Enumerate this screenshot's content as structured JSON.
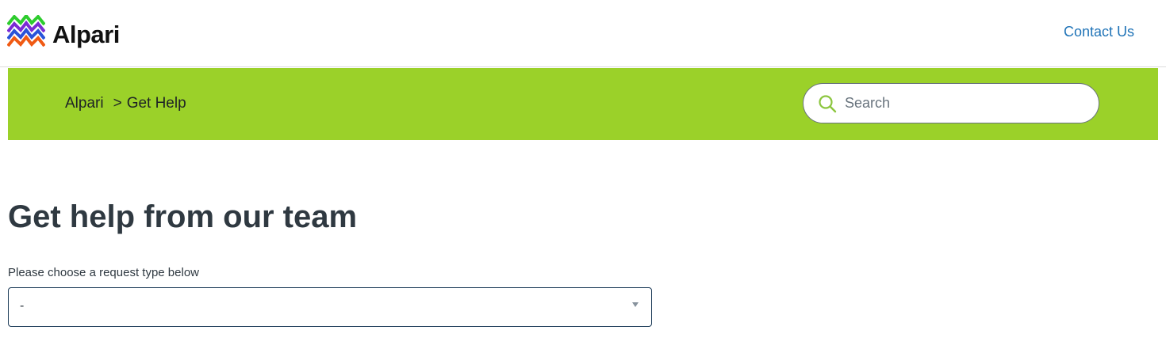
{
  "header": {
    "logo_text": "Alpari",
    "logo_icon": "alpari-zigzag-logo",
    "contact_link": "Contact Us"
  },
  "hero": {
    "breadcrumb": [
      "Alpari",
      "Get Help"
    ],
    "breadcrumb_separator": ">",
    "search": {
      "placeholder": "Search",
      "value": ""
    },
    "background_color": "#9bd129"
  },
  "main": {
    "title": "Get help from our team",
    "request_type": {
      "label": "Please choose a request type below",
      "selected_value": "-"
    }
  },
  "colors": {
    "accent": "#9bd129",
    "link": "#1f73b7",
    "text": "#2f3941"
  }
}
